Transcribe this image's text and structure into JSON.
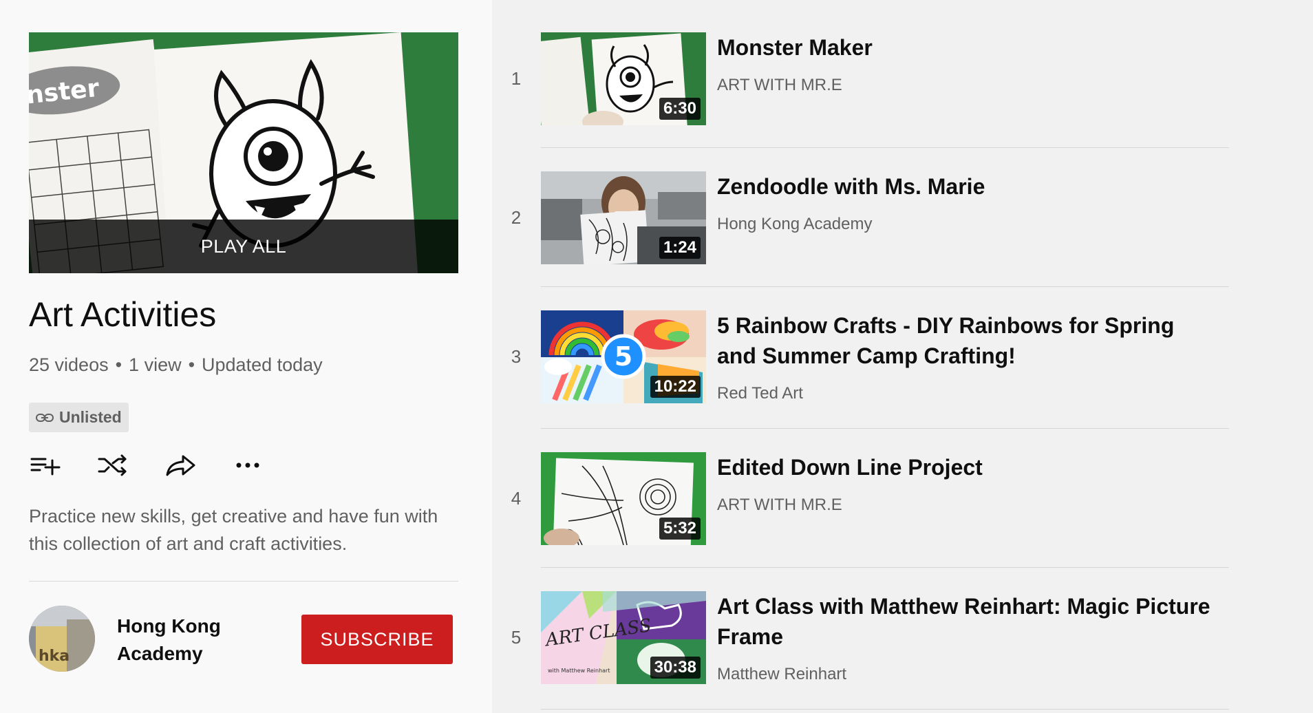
{
  "playlist": {
    "play_all": "PLAY ALL",
    "title": "Art Activities",
    "meta": [
      "25 videos",
      "•",
      "1 view",
      "•",
      "Updated today"
    ],
    "privacy": "Unlisted",
    "description": "Practice new skills, get creative and have fun with this collection of art and craft activities.",
    "channel": "Hong Kong Academy",
    "subscribe": "SUBSCRIBE",
    "avatar_text": "hka",
    "hero_paper_text": "nster",
    "actions": [
      "add-to-queue-icon",
      "shuffle-icon",
      "share-icon",
      "more-icon"
    ]
  },
  "videos": [
    {
      "index": "1",
      "title": "Monster Maker",
      "channel": "ART WITH MR.E",
      "duration": "6:30"
    },
    {
      "index": "2",
      "title": "Zendoodle with Ms. Marie",
      "channel": "Hong Kong Academy",
      "duration": "1:24"
    },
    {
      "index": "3",
      "title": "5 Rainbow Crafts - DIY Rainbows for Spring and Summer Camp Crafting!",
      "channel": "Red Ted Art",
      "duration": "10:22",
      "badge": "5"
    },
    {
      "index": "4",
      "title": "Edited Down Line Project",
      "channel": "ART WITH MR.E",
      "duration": "5:32"
    },
    {
      "index": "5",
      "title": "Art Class with Matthew Reinhart: Magic Picture Frame",
      "channel": "Matthew Reinhart",
      "duration": "30:38",
      "thumb_text": "ART CLASS",
      "thumb_sub": "with Matthew Reinhart"
    }
  ],
  "colors": {
    "subscribe": "#cc1e1e",
    "green": "#2e7d3c"
  }
}
